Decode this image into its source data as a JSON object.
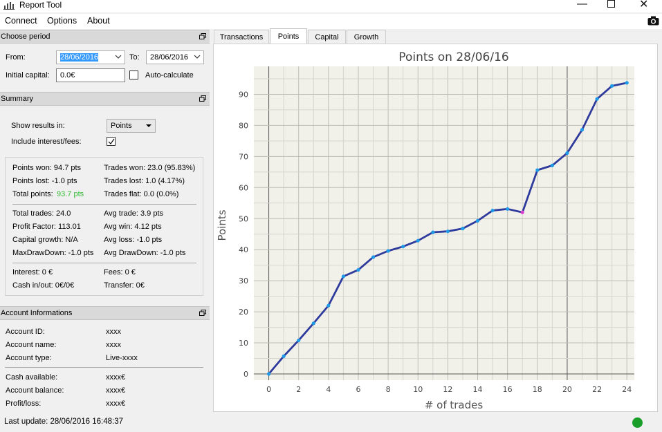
{
  "app": {
    "title": "Report Tool"
  },
  "menu": {
    "items": [
      "Connect",
      "Options",
      "About"
    ]
  },
  "period": {
    "header": "Choose period",
    "from_label": "From:",
    "from_value": "28/06/2016",
    "to_label": "To:",
    "to_value": "28/06/2016",
    "capital_label": "Initial capital:",
    "capital_value": "0.0€",
    "autocalc_label": "Auto-calculate"
  },
  "summary": {
    "header": "Summary",
    "show_label": "Show results in:",
    "show_value": "Points",
    "include_label": "Include interest/fees:",
    "points_won": "Points won: 94.7 pts",
    "trades_won": "Trades won: 23.0 (95.83%)",
    "points_lost": "Points lost: -1.0 pts",
    "trades_lost": "Trades lost: 1.0 (4.17%)",
    "total_points_label": "Total points:",
    "total_points_value": "93.7 pts",
    "trades_flat": "Trades flat: 0.0 (0.0%)",
    "total_trades": "Total trades: 24.0",
    "avg_trade": "Avg trade: 3.9 pts",
    "profit_factor": "Profit Factor: 113.01",
    "avg_win": "Avg win: 4.12 pts",
    "capital_growth": "Capital growth: N/A",
    "avg_loss": "Avg loss: -1.0 pts",
    "max_drawdown": "MaxDrawDown: -1.0 pts",
    "avg_drawdown": "Avg DrawDown: -1.0 pts",
    "interest": "Interest: 0 €",
    "fees": "Fees: 0 €",
    "cash": "Cash in/out: 0€/0€",
    "transfer": "Transfer: 0€"
  },
  "account": {
    "header": "Account Informations",
    "id_label": "Account ID:",
    "id_value": "xxxx",
    "name_label": "Account name:",
    "name_value": "xxxx",
    "type_label": "Account type:",
    "type_value": "Live-xxxx",
    "cash_label": "Cash available:",
    "cash_value": "xxxx€",
    "balance_label": "Account balance:",
    "balance_value": "xxxx€",
    "pl_label": "Profit/loss:",
    "pl_value": "xxxx€"
  },
  "tabs": [
    "Transactions",
    "Points",
    "Capital",
    "Growth"
  ],
  "active_tab": "Points",
  "status": {
    "last_update": "Last update: 28/06/2016 16:48:37",
    "indicator_color": "#1a9e2a"
  },
  "colors": {
    "total_points": "#33b833",
    "line": "#2e3a9c",
    "point": "#1e9be8",
    "point_highlight": "#e040d0"
  },
  "chart_data": {
    "type": "line",
    "title": "Points on 28/06/16",
    "xlabel": "# of trades",
    "ylabel": "Points",
    "xlim": [
      -1,
      24.5
    ],
    "ylim": [
      -2,
      99
    ],
    "xticks": [
      0,
      2,
      4,
      6,
      8,
      10,
      12,
      14,
      16,
      18,
      20,
      22,
      24
    ],
    "yticks": [
      0,
      10,
      20,
      30,
      40,
      50,
      60,
      70,
      80,
      90
    ],
    "grid": true,
    "x": [
      0,
      1,
      2,
      3,
      4,
      5,
      6,
      7,
      8,
      9,
      10,
      11,
      12,
      13,
      14,
      15,
      16,
      17,
      18,
      19,
      20,
      21,
      22,
      23,
      24
    ],
    "y": [
      0,
      5.7,
      10.8,
      16.3,
      22.0,
      31.4,
      33.5,
      37.6,
      39.6,
      41.0,
      42.9,
      45.6,
      45.9,
      46.8,
      49.3,
      52.6,
      53.1,
      52.0,
      65.6,
      67.1,
      71.1,
      78.6,
      88.5,
      92.7,
      93.7
    ],
    "highlight_index": 17
  }
}
